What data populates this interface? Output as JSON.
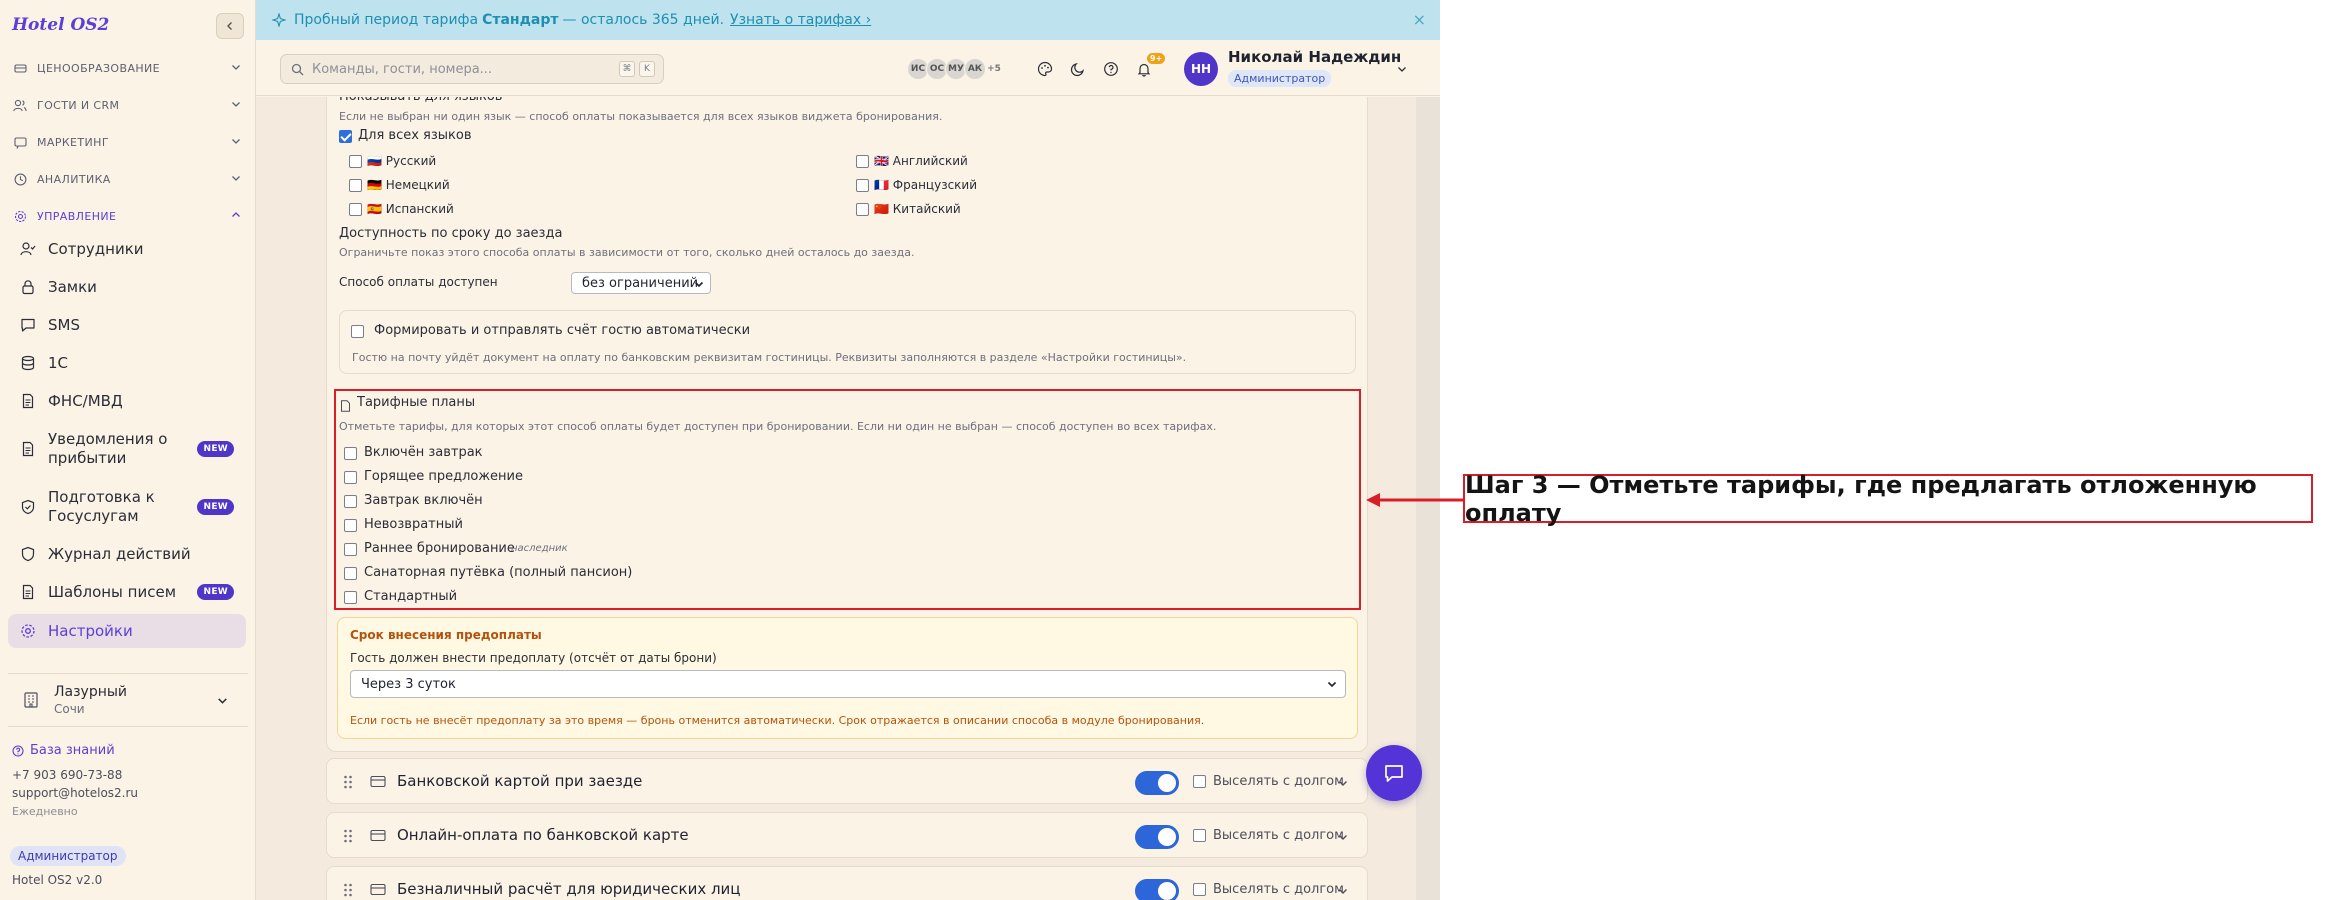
{
  "app": {
    "logo": "Hotel OS2"
  },
  "sidebar": {
    "groups": [
      {
        "label": "ЦЕНООБРАЗОВАНИЕ",
        "icon": "price-tag-icon"
      },
      {
        "label": "ГОСТИ И CRM",
        "icon": "users-icon"
      },
      {
        "label": "МАРКЕТИНГ",
        "icon": "megaphone-icon"
      },
      {
        "label": "АНАЛИТИКА",
        "icon": "clock-chart-icon"
      },
      {
        "label": "УПРАВЛЕНИЕ",
        "icon": "gear-icon"
      }
    ],
    "items": [
      {
        "label": "Сотрудники",
        "icon": "staff-icon"
      },
      {
        "label": "Замки",
        "icon": "lock-icon"
      },
      {
        "label": "SMS",
        "icon": "message-icon"
      },
      {
        "label": "1С",
        "icon": "database-icon"
      },
      {
        "label": "ФНС/МВД",
        "icon": "document-icon"
      },
      {
        "label": "Уведомления о прибытии",
        "icon": "document-icon",
        "badge": "NEW"
      },
      {
        "label": "Подготовка к Госуслугам",
        "icon": "shield-check-icon",
        "badge": "NEW"
      },
      {
        "label": "Журнал действий",
        "icon": "shield-icon"
      },
      {
        "label": "Шаблоны писем",
        "icon": "document-icon",
        "badge": "NEW"
      },
      {
        "label": "Настройки",
        "icon": "gear-icon"
      }
    ],
    "hotel": {
      "name": "Лазурный",
      "city": "Сочи"
    },
    "footer": {
      "knowledge_base": "База знаний",
      "phone": "+7 903 690-73-88",
      "email": "support@hotelos2.ru",
      "hours": "Ежедневно",
      "role": "Администратор",
      "version": "Hotel OS2 v2.0"
    }
  },
  "banner": {
    "prefix": "Пробный период тарифа",
    "plan": "Стандарт",
    "suffix": "— осталось 365 дней.",
    "link": "Узнать о тарифах ›",
    "close": "×"
  },
  "topbar": {
    "search_placeholder": "Команды, гости, номера...",
    "kbd1": "⌘",
    "kbd2": "K",
    "avatars": [
      "ИС",
      "ОС",
      "МУ",
      "АК",
      "+5"
    ],
    "notif_count": "9+",
    "user": {
      "initials": "НН",
      "name": "Николай Надеждин",
      "role": "Администратор"
    }
  },
  "content": {
    "langs_title": "Показывать для языков",
    "langs_hint": "Если не выбран ни один язык — способ оплаты показывается для всех языков виджета бронирования.",
    "all_langs": "Для всех языков",
    "languages": [
      {
        "flag": "🇷🇺",
        "name": "Русский"
      },
      {
        "flag": "🇩🇪",
        "name": "Немецкий"
      },
      {
        "flag": "🇪🇸",
        "name": "Испанский"
      },
      {
        "flag": "🇬🇧",
        "name": "Английский"
      },
      {
        "flag": "🇫🇷",
        "name": "Французский"
      },
      {
        "flag": "🇨🇳",
        "name": "Китайский"
      }
    ],
    "avail_title": "Доступность по сроку до заезда",
    "avail_hint": "Ограничьте показ этого способа оплаты в зависимости от того, сколько дней осталось до заезда.",
    "avail_label": "Способ оплаты доступен",
    "avail_value": "без ограничений",
    "invoice_label": "Формировать и отправлять счёт гостю автоматически",
    "invoice_hint": "Гостю на почту уйдёт документ на оплату по банковским реквизитам гостиницы. Реквизиты заполняются в разделе «Настройки гостиницы».",
    "rates_title": "Тарифные планы",
    "rates_hint": "Отметьте тарифы, для которых этот способ оплаты будет доступен при бронировании. Если ни один не выбран — способ доступен во всех тарифах.",
    "rates": [
      {
        "label": "Включён завтрак",
        "tag": ""
      },
      {
        "label": "Горящее предложение",
        "tag": ""
      },
      {
        "label": "Завтрак включён",
        "tag": ""
      },
      {
        "label": "Невозвратный",
        "tag": ""
      },
      {
        "label": "Раннее бронирование",
        "tag": "наследник"
      },
      {
        "label": "Санаторная путёвка (полный пансион)",
        "tag": ""
      },
      {
        "label": "Стандартный",
        "tag": ""
      }
    ],
    "deadline_title": "Срок внесения предоплаты",
    "deadline_label": "Гость должен внести предоплату (отсчёт от даты брони)",
    "deadline_value": "Через 3 суток",
    "deadline_warn": "Если гость не внесёт предоплату за это время — бронь отменится автоматически. Срок отражается в описании способа в модуле бронирования."
  },
  "methods": [
    {
      "label": "Банковской картой при заезде",
      "debt": "Выселять с долгом"
    },
    {
      "label": "Онлайн-оплата по банковской карте",
      "debt": "Выселять с долгом"
    },
    {
      "label": "Безналичный расчёт для юридических лиц",
      "debt": "Выселять с долгом"
    }
  ],
  "annotation": {
    "text": "Шаг 3 — Отметьте тарифы, где предлагать отложенную оплату"
  },
  "colors": {
    "accent": "#5b3fd6",
    "highlight": "#d81e28",
    "toggle": "#2c66d9",
    "banner": "#bfe3ee"
  }
}
